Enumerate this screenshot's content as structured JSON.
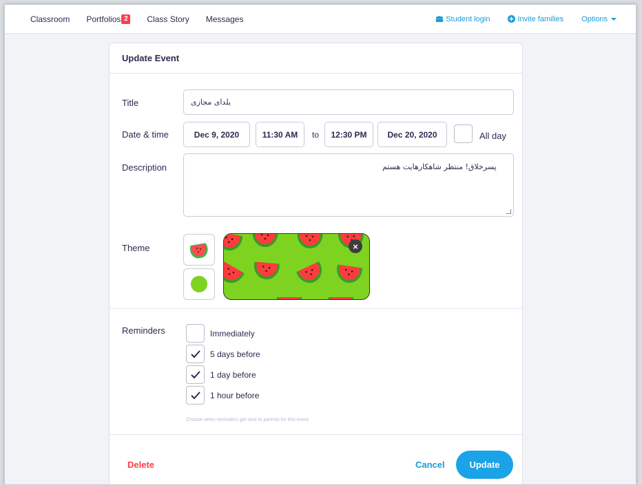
{
  "nav": {
    "items": [
      {
        "label": "Classroom"
      },
      {
        "label": "Portfolios",
        "badge": "2"
      },
      {
        "label": "Class Story"
      },
      {
        "label": "Messages"
      }
    ],
    "student_login": "Student login",
    "invite_families": "Invite families",
    "options": "Options"
  },
  "form": {
    "header": "Update Event",
    "title_label": "Title",
    "title_value": "یلدای مجازی",
    "datetime_label": "Date & time",
    "start_date": "Dec 9, 2020",
    "start_time": "11:30 AM",
    "to_text": "to",
    "end_time": "12:30 PM",
    "end_date": "Dec 20, 2020",
    "all_day_label": "All day",
    "all_day_checked": false,
    "description_label": "Description",
    "description_value": "پسرخلاق! منتظر شاهکارهایت هستم",
    "theme_label": "Theme",
    "reminders_label": "Reminders",
    "reminders": [
      {
        "label": "Immediately",
        "checked": false
      },
      {
        "label": "5 days before",
        "checked": true
      },
      {
        "label": "1 day before",
        "checked": true
      },
      {
        "label": "1 hour before",
        "checked": true
      }
    ],
    "reminders_hint": "Choose when reminders get sent to parents for this event",
    "delete_label": "Delete",
    "cancel_label": "Cancel",
    "update_label": "Update"
  },
  "colors": {
    "accent": "#1aa3e8",
    "danger": "#ff3b4a",
    "theme_green": "#7ed321",
    "text": "#2c2a50"
  }
}
